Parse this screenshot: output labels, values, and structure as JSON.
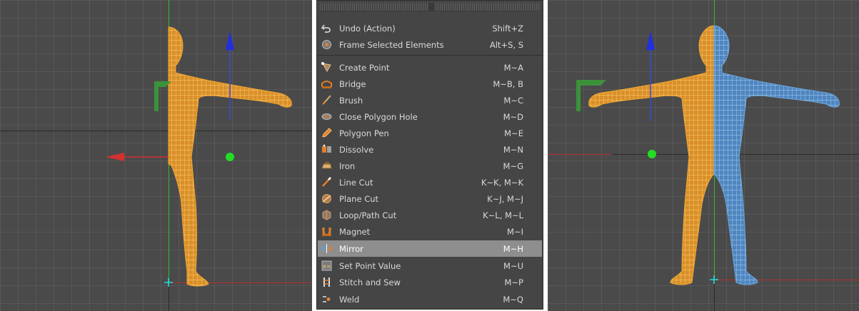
{
  "menu": {
    "group1": [
      {
        "label": "Undo (Action)",
        "shortcut": "Shift+Z",
        "icon": "undo-icon"
      },
      {
        "label": "Frame Selected Elements",
        "shortcut": "Alt+S, S",
        "icon": "frame-selected-icon"
      }
    ],
    "group2": [
      {
        "label": "Create Point",
        "shortcut": "M~A",
        "icon": "create-point-icon"
      },
      {
        "label": "Bridge",
        "shortcut": "M~B, B",
        "icon": "bridge-icon"
      },
      {
        "label": "Brush",
        "shortcut": "M~C",
        "icon": "brush-icon"
      },
      {
        "label": "Close Polygon Hole",
        "shortcut": "M~D",
        "icon": "close-polygon-hole-icon"
      },
      {
        "label": "Polygon Pen",
        "shortcut": "M~E",
        "icon": "polygon-pen-icon"
      },
      {
        "label": "Dissolve",
        "shortcut": "M~N",
        "icon": "dissolve-icon"
      },
      {
        "label": "Iron",
        "shortcut": "M~G",
        "icon": "iron-icon"
      },
      {
        "label": "Line Cut",
        "shortcut": "K~K, M~K",
        "icon": "line-cut-icon"
      },
      {
        "label": "Plane Cut",
        "shortcut": "K~J, M~J",
        "icon": "plane-cut-icon"
      },
      {
        "label": "Loop/Path Cut",
        "shortcut": "K~L, M~L",
        "icon": "loop-path-cut-icon"
      },
      {
        "label": "Magnet",
        "shortcut": "M~I",
        "icon": "magnet-icon"
      },
      {
        "label": "Mirror",
        "shortcut": "M~H",
        "icon": "mirror-icon",
        "selected": true
      },
      {
        "label": "Set Point Value",
        "shortcut": "M~U",
        "icon": "set-point-value-icon"
      },
      {
        "label": "Stitch and Sew",
        "shortcut": "M~P",
        "icon": "stitch-and-sew-icon"
      },
      {
        "label": "Weld",
        "shortcut": "M~Q",
        "icon": "weld-icon"
      }
    ]
  },
  "colors": {
    "viewport_bg": "#4a4a4a",
    "mesh_orange": "#f5a830",
    "mesh_blue": "#6fa6dc",
    "axis_green": "#33b833",
    "axis_red": "#d43030",
    "axis_blue": "#2030e0",
    "menu_bg": "#454545",
    "menu_selected": "#8e8e8e"
  }
}
